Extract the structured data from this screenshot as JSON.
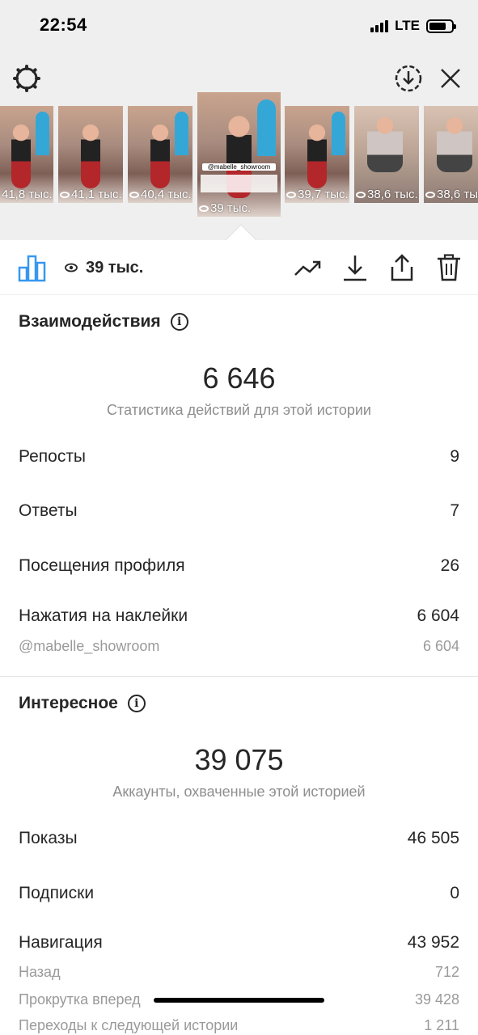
{
  "status": {
    "time": "22:54",
    "network": "LTE"
  },
  "header": {
    "icons": [
      "gear-icon",
      "download-circle-icon",
      "close-icon"
    ]
  },
  "stories": [
    {
      "views": "41,8 тыс."
    },
    {
      "views": "41,1 тыс."
    },
    {
      "views": "40,4 тыс."
    },
    {
      "views": "39 тыс.",
      "sticker": "@mabelle_showroom",
      "selected": true
    },
    {
      "views": "39,7 тыс."
    },
    {
      "views": "38,6 тыс."
    },
    {
      "views": "38,6 тыс."
    }
  ],
  "toolbar": {
    "views": "39 тыс.",
    "icons": [
      "bar-chart-icon",
      "eye-icon",
      "trend-icon",
      "download-icon",
      "share-icon",
      "trash-icon"
    ]
  },
  "interactions": {
    "title": "Взаимодействия",
    "total": "6 646",
    "subtitle": "Статистика действий для этой истории",
    "rows": [
      {
        "label": "Репосты",
        "value": "9"
      },
      {
        "label": "Ответы",
        "value": "7"
      },
      {
        "label": "Посещения профиля",
        "value": "26"
      },
      {
        "label": "Нажатия на наклейки",
        "value": "6 604"
      }
    ],
    "sub_rows": [
      {
        "label": "@mabelle_showroom",
        "value": "6 604"
      }
    ]
  },
  "discovery": {
    "title": "Интересное",
    "total": "39 075",
    "subtitle": "Аккаунты, охваченные этой историей",
    "rows": [
      {
        "label": "Показы",
        "value": "46 505"
      },
      {
        "label": "Подписки",
        "value": "0"
      },
      {
        "label": "Навигация",
        "value": "43 952"
      }
    ],
    "sub_rows": [
      {
        "label": "Назад",
        "value": "712"
      },
      {
        "label": "Прокрутка вперед",
        "value": "39 428"
      },
      {
        "label": "Переходы к следующей истории",
        "value": "1 211"
      }
    ]
  },
  "colors": {
    "accent": "#3897f0",
    "text": "#262626",
    "muted": "#8e8e8e"
  }
}
